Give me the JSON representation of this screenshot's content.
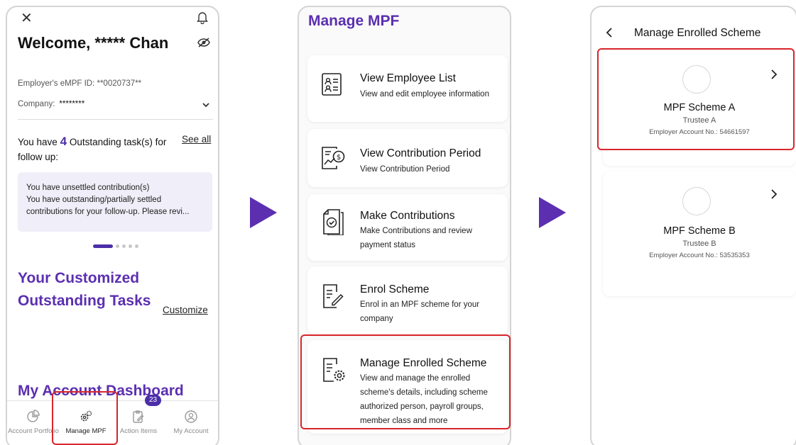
{
  "screen1": {
    "welcome": "Welcome, ***** Chan",
    "employer_id": "Employer's eMPF ID: **0020737**",
    "company_label": "Company:",
    "company_value": "********",
    "tasks_prefix": "You have",
    "tasks_count": "4",
    "tasks_suffix": "Outstanding task(s) for follow up:",
    "see_all": "See all",
    "notice_line1": "You have unsettled contribution(s)",
    "notice_line2": "You have outstanding/partially settled",
    "notice_line3": "contributions for your follow-up. Please revi...",
    "customized_title": "Your Customized Outstanding Tasks",
    "customize_link": "Customize",
    "dashboard_title": "My Account Dashboard",
    "tabs": [
      {
        "label": "Account Portfolio",
        "icon": "pie-chart-icon"
      },
      {
        "label": "Manage MPF",
        "icon": "gears-icon"
      },
      {
        "label": "Action Items",
        "icon": "clipboard-edit-icon"
      },
      {
        "label": "My Account",
        "icon": "user-circle-icon"
      }
    ],
    "action_badge": "23"
  },
  "screen2": {
    "title": "Manage MPF",
    "items": [
      {
        "title": "View Employee List",
        "desc": "View and edit employee information",
        "icon": "employee-list-icon"
      },
      {
        "title": "View Contribution Period",
        "desc": "View Contribution Period",
        "icon": "contribution-period-icon"
      },
      {
        "title": "Make Contributions",
        "desc": "Make Contributions and review payment status",
        "icon": "make-contribution-icon"
      },
      {
        "title": "Enrol Scheme",
        "desc": "Enrol in an MPF scheme for your company",
        "icon": "enrol-scheme-icon"
      },
      {
        "title": "Manage Enrolled Scheme",
        "desc": "View and manage the enrolled scheme's details, including scheme authorized person, payroll groups, member class and more",
        "icon": "manage-scheme-icon"
      }
    ]
  },
  "screen3": {
    "title": "Manage Enrolled Scheme",
    "schemes": [
      {
        "name": "MPF Scheme A",
        "trustee": "Trustee A",
        "account": "Employer Account No.: 54661597"
      },
      {
        "name": "MPF Scheme B",
        "trustee": "Trustee B",
        "account": "Employer Account No.: 53535353"
      }
    ]
  },
  "colors": {
    "brand_purple": "#5b2fb0",
    "highlight_red": "#d8262a",
    "notice_bg": "#f0eef8"
  }
}
